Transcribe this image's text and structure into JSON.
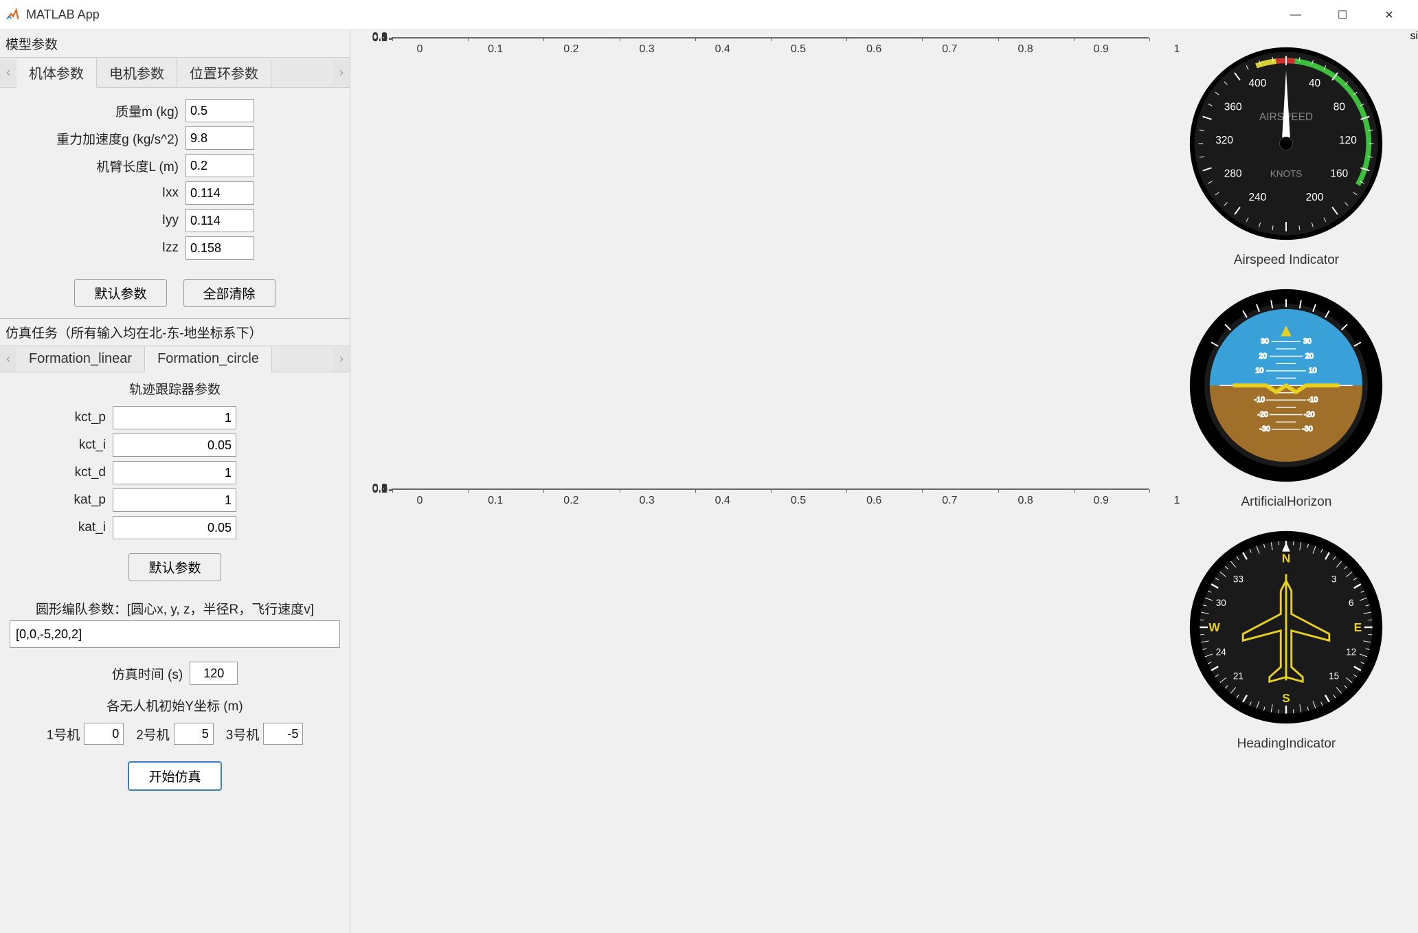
{
  "window": {
    "title": "MATLAB App"
  },
  "panels": {
    "model_params": {
      "title": "模型参数",
      "tabs": [
        "机体参数",
        "电机参数",
        "位置环参数"
      ],
      "fields": {
        "mass": {
          "label": "质量m (kg)",
          "value": "0.5"
        },
        "gravity": {
          "label": "重力加速度g (kg/s^2)",
          "value": "9.8"
        },
        "arm": {
          "label": "机臂长度L (m)",
          "value": "0.2"
        },
        "ixx": {
          "label": "Ixx",
          "value": "0.114"
        },
        "iyy": {
          "label": "Iyy",
          "value": "0.114"
        },
        "izz": {
          "label": "Izz",
          "value": "0.158"
        }
      },
      "btn_default": "默认参数",
      "btn_clear": "全部清除"
    },
    "sim_tasks": {
      "title": "仿真任务（所有输入均在北-东-地坐标系下）",
      "tabs": [
        "Formation_linear",
        "Formation_circle"
      ],
      "tracker_title": "轨迹跟踪器参数",
      "fields": {
        "kct_p": {
          "label": "kct_p",
          "value": "1"
        },
        "kct_i": {
          "label": "kct_i",
          "value": "0.05"
        },
        "kct_d": {
          "label": "kct_d",
          "value": "1"
        },
        "kat_p": {
          "label": "kat_p",
          "value": "1"
        },
        "kat_i": {
          "label": "kat_i",
          "value": "0.05"
        }
      },
      "btn_default": "默认参数",
      "circle_label": "圆形编队参数：[圆心x, y, z，半径R，飞行速度v]",
      "circle_value": "[0,0,-5,20,2]",
      "sim_time_label": "仿真时间 (s)",
      "sim_time_value": "120",
      "init_y_label": "各无人机初始Y坐标 (m)",
      "uavs": {
        "u1": {
          "label": "1号机",
          "value": "0"
        },
        "u2": {
          "label": "2号机",
          "value": "5"
        },
        "u3": {
          "label": "3号机",
          "value": "-5"
        }
      },
      "btn_start": "开始仿真"
    }
  },
  "gauges": {
    "airspeed": "Airspeed Indicator",
    "horizon": "ArtificialHorizon",
    "heading": "HeadingIndicator",
    "airspeed_text": {
      "label_center": "AIRSPEED",
      "label_knots": "KNOTS"
    }
  },
  "chart_data": [
    {
      "type": "line",
      "title": "",
      "xlabel": "",
      "ylabel": "",
      "x": [],
      "y": [],
      "xlim": [
        0,
        1
      ],
      "ylim": [
        0,
        1
      ],
      "xticks": [
        0,
        0.1,
        0.2,
        0.3,
        0.4,
        0.5,
        0.6,
        0.7,
        0.8,
        0.9,
        1
      ],
      "yticks": [
        0,
        0.1,
        0.2,
        0.3,
        0.4,
        0.5,
        0.6,
        0.7,
        0.8,
        0.9,
        1
      ]
    },
    {
      "type": "line",
      "title": "",
      "xlabel": "",
      "ylabel": "",
      "x": [],
      "y": [],
      "xlim": [
        0,
        1
      ],
      "ylim": [
        0,
        1
      ],
      "xticks": [
        0,
        0.1,
        0.2,
        0.3,
        0.4,
        0.5,
        0.6,
        0.7,
        0.8,
        0.9,
        1
      ],
      "yticks": [
        0,
        0.1,
        0.2,
        0.3,
        0.4,
        0.5,
        0.6,
        0.7,
        0.8,
        0.9,
        1
      ]
    }
  ]
}
